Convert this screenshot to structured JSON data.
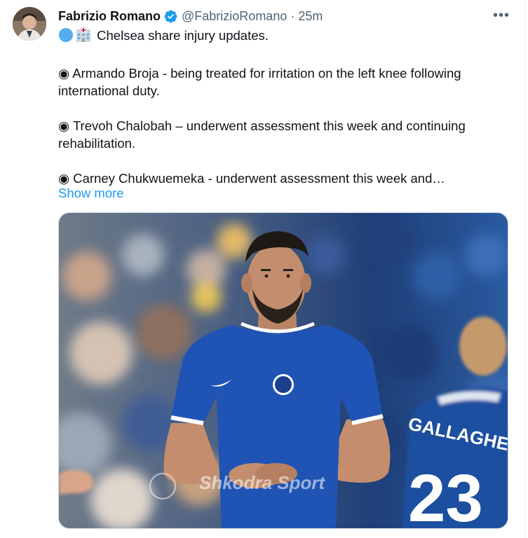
{
  "tweet": {
    "author_name": "Fabrizio Romano",
    "author_handle": "@FabrizioRomano",
    "separator": "·",
    "timestamp": "25m",
    "more_menu": "•••",
    "lines": {
      "intro": "Chelsea share injury updates.",
      "item1": "◉ Armando Broja - being treated for irritation on the left knee following international duty.",
      "item2": "◉ Trevoh Chalobah – underwent assessment this week and continuing rehabilitation.",
      "item3": "◉ Carney Chukwuemeka - underwent assessment this week and…"
    },
    "show_more": "Show more"
  },
  "media": {
    "shirt_number": "23",
    "back_name": "GALLAGHER",
    "watermark": "Shkodra Sport"
  },
  "colors": {
    "accent": "#1d9bf0",
    "text": "#0f1419",
    "muted": "#536471",
    "chelsea_blue": "#1a4fa3"
  },
  "icons": [
    "verified-badge-icon",
    "blue-circle-emoji-icon",
    "hospital-emoji-icon",
    "more-options-icon"
  ]
}
